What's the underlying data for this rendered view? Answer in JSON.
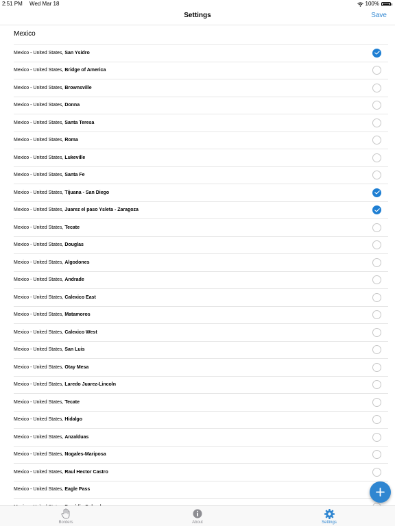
{
  "status": {
    "time": "2:51 PM",
    "date": "Wed Mar 18",
    "battery": "100%"
  },
  "nav": {
    "title": "Settings",
    "save_label": "Save"
  },
  "section_title": "Mexico",
  "crossing_prefix": "Mexico - United States, ",
  "crossings": [
    {
      "city": "San Ysidro",
      "checked": true
    },
    {
      "city": "Bridge of America",
      "checked": false
    },
    {
      "city": "Brownsville",
      "checked": false
    },
    {
      "city": "Donna",
      "checked": false
    },
    {
      "city": "Santa Teresa",
      "checked": false
    },
    {
      "city": "Roma",
      "checked": false
    },
    {
      "city": "Lukeville",
      "checked": false
    },
    {
      "city": "Santa Fe",
      "checked": false
    },
    {
      "city": "Tijuana - San Diego",
      "checked": true
    },
    {
      "city": "Juarez el paso Ysleta - Zaragoza",
      "checked": true
    },
    {
      "city": "Tecate",
      "checked": false
    },
    {
      "city": "Douglas",
      "checked": false
    },
    {
      "city": "Algodones",
      "checked": false
    },
    {
      "city": "Andrade",
      "checked": false
    },
    {
      "city": "Calexico East",
      "checked": false
    },
    {
      "city": "Matamoros",
      "checked": false
    },
    {
      "city": "Calexico West",
      "checked": false
    },
    {
      "city": "San Luis",
      "checked": false
    },
    {
      "city": "Otay Mesa",
      "checked": false
    },
    {
      "city": "Laredo Juarez-Lincoln",
      "checked": false
    },
    {
      "city": "Tecate",
      "checked": false
    },
    {
      "city": "Hidalgo",
      "checked": false
    },
    {
      "city": "Anzalduas",
      "checked": false
    },
    {
      "city": "Nogales-Mariposa",
      "checked": false
    },
    {
      "city": "Raul Hector Castro",
      "checked": false
    },
    {
      "city": "Eagle Pass",
      "checked": false
    },
    {
      "city": "Presidio Columbus",
      "checked": false
    }
  ],
  "tabs": [
    {
      "label": "Borders",
      "icon": "hand-icon",
      "active": false
    },
    {
      "label": "About",
      "icon": "info-icon",
      "active": false
    },
    {
      "label": "Settings",
      "icon": "gear-icon",
      "active": true
    }
  ],
  "colors": {
    "accent": "#2f86d1",
    "check": "#1f7fd3",
    "inactive": "#8e8e93"
  }
}
